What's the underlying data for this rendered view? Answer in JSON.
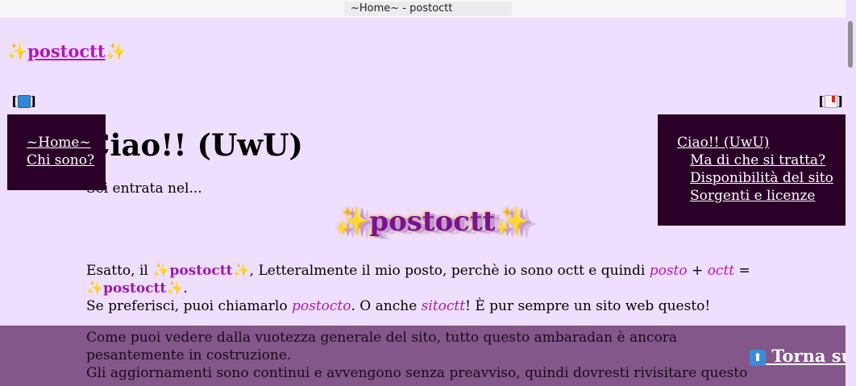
{
  "window": {
    "title": "~Home~ - postoctt"
  },
  "logo": {
    "star": "✨",
    "text": "postoctt"
  },
  "toggles": {
    "left_open": "[",
    "left_close": "]",
    "right_open": "[",
    "right_close": "]"
  },
  "left_nav": {
    "items": [
      {
        "label": "~Home~"
      },
      {
        "label": "Chi sono?"
      }
    ]
  },
  "right_nav": {
    "items": [
      {
        "label": "Ciao!! (UwU)"
      },
      {
        "label": "Ma di che si tratta?"
      },
      {
        "label": "Disponibilità del sito"
      },
      {
        "label": "Sorgenti e licenze"
      }
    ]
  },
  "main": {
    "heading": "Ciao!! (UwU)",
    "intro": "Sei entrata nel...",
    "big_title": "✨postoctt✨",
    "p1": {
      "t1": "Esatto, il ",
      "brand": "postoctt",
      "t2": ", Letteralmente il mio posto, perchè io sono octt e quindi ",
      "w1": "posto",
      "plus": " + ",
      "w2": "octt",
      "eq": " = ",
      "end": "."
    },
    "p2": {
      "t1": "Se preferisci, puoi chiamarlo ",
      "w1": "postocto",
      "t2": ". O anche ",
      "w2": "sitoctt",
      "t3": "! È pur sempre un sito web questo!"
    },
    "notice": "Come puoi vedere dalla vuotezza generale del sito, tutto questo ambaradan è ancora pesantemente in costruzione.\nGli aggiornamenti sono continui e avvengono senza preavviso, quindi dovresti rivisitare questo",
    "back_to_top": {
      "icon": "⬆",
      "label": "Torna su"
    }
  },
  "colors": {
    "background": "#efdfff",
    "panel": "#2a0028",
    "accent": "#b217b8",
    "band": "#83578a"
  }
}
